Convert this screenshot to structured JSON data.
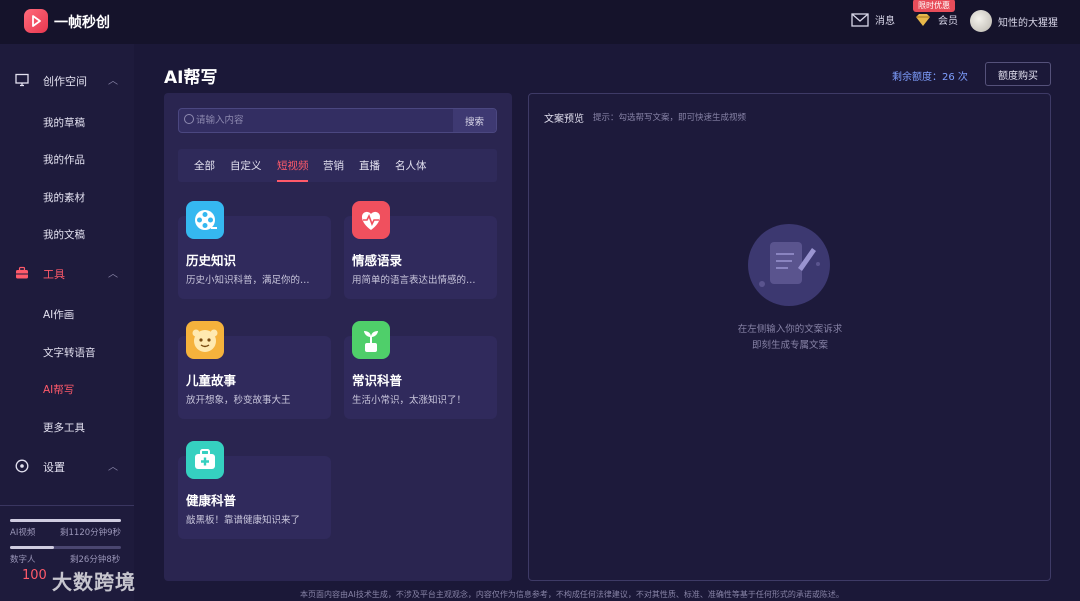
{
  "app": {
    "name": "一帧秒创"
  },
  "topbar": {
    "messages_label": "消息",
    "member_label": "会员",
    "promo_badge": "限时优惠",
    "username": "知性的大猩猩"
  },
  "sidebar": {
    "group_create": "创作空间",
    "create_items": [
      "我的草稿",
      "我的作品",
      "我的素材",
      "我的文稿"
    ],
    "group_tools": "工具",
    "tool_items": [
      "AI作画",
      "文字转语音",
      "AI帮写",
      "更多工具"
    ],
    "group_settings": "设置",
    "usage": [
      {
        "label": "AI视频",
        "remaining": "剩1120分钟9秒",
        "fill": 1.0
      },
      {
        "label": "数字人",
        "remaining": "剩26分钟8秒",
        "fill": 0.4
      }
    ],
    "watermark": "大数跨境",
    "watermark_sub": "100"
  },
  "main": {
    "title": "AI帮写",
    "quota_text": "剩余额度：26 次",
    "buy_label": "额度购买",
    "search_placeholder": "请输入内容",
    "search_button": "搜索",
    "tabs": [
      "全部",
      "自定义",
      "短视频",
      "营销",
      "直播",
      "名人体"
    ],
    "active_tab": "短视频",
    "cards": [
      {
        "title": "历史知识",
        "desc": "历史小知识科普，满足你的…",
        "icon": "film-reel-icon",
        "color": "#35b8f0"
      },
      {
        "title": "情感语录",
        "desc": "用简单的语言表达出情感的…",
        "icon": "heart-pulse-icon",
        "color": "#f0505e"
      },
      {
        "title": "儿童故事",
        "desc": "放开想象，秒变故事大王",
        "icon": "child-face-icon",
        "color": "#f5b23c"
      },
      {
        "title": "常识科普",
        "desc": "生活小常识，太涨知识了！",
        "icon": "sprout-icon",
        "color": "#4fcf6a"
      },
      {
        "title": "健康科普",
        "desc": "敲黑板！靠谱健康知识来了",
        "icon": "medical-kit-icon",
        "color": "#35d0c0"
      }
    ]
  },
  "preview": {
    "title": "文案预览",
    "hint": "提示：勾选帮写文案，即可快速生成视频",
    "empty_line1": "在左侧输入你的文案诉求",
    "empty_line2": "即刻生成专属文案"
  },
  "footer_note": "本页面内容由AI技术生成，不涉及平台主观观念，内容仅作为信息参考，不构成任何法律建议，不对其性质、标准、准确性等基于任何形式的承诺或陈述。"
}
